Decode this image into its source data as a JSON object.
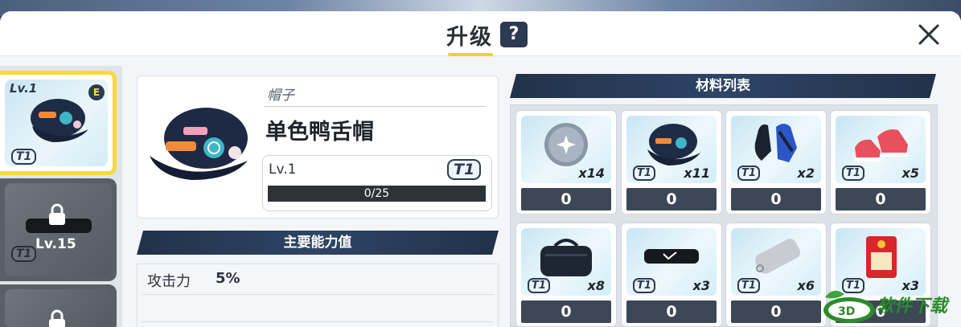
{
  "header": {
    "title": "升级",
    "help_label": "?"
  },
  "left_slots": [
    {
      "level": "Lv.1",
      "rank": "E",
      "tier": "T1",
      "state": "selected",
      "icon": "cap-icon"
    },
    {
      "level": "Lv.15",
      "tier": "T1",
      "state": "locked",
      "icon": "headband-icon"
    },
    {
      "level": "",
      "state": "locked",
      "icon": "lock-icon"
    }
  ],
  "item": {
    "category": "帽子",
    "name": "单色鸭舌帽",
    "level": "Lv.1",
    "tier": "T1",
    "exp_text": "0/25",
    "exp_progress": 0
  },
  "stats": {
    "section_title": "主要能力值",
    "rows": [
      {
        "label": "攻击力",
        "value": "5%"
      }
    ]
  },
  "materials": {
    "section_title": "材料列表",
    "items": [
      {
        "icon": "crystal-orb-icon",
        "count": "x14",
        "tier": "",
        "qty": "0"
      },
      {
        "icon": "cap-icon",
        "count": "x11",
        "tier": "T1",
        "qty": "0"
      },
      {
        "icon": "gloves-icon",
        "count": "x2",
        "tier": "T1",
        "qty": "0"
      },
      {
        "icon": "sneakers-icon",
        "count": "x5",
        "tier": "T1",
        "qty": "0"
      },
      {
        "icon": "duffel-bag-icon",
        "count": "x8",
        "tier": "T1",
        "qty": "0"
      },
      {
        "icon": "headband-icon",
        "count": "x3",
        "tier": "T1",
        "qty": "0"
      },
      {
        "icon": "dog-tag-icon",
        "count": "x6",
        "tier": "T1",
        "qty": "0"
      },
      {
        "icon": "charm-pouch-icon",
        "count": "x3",
        "tier": "T1",
        "qty": "0"
      }
    ]
  },
  "colors": {
    "accent_yellow": "#f7d93a",
    "navy": "#2c3a52"
  }
}
